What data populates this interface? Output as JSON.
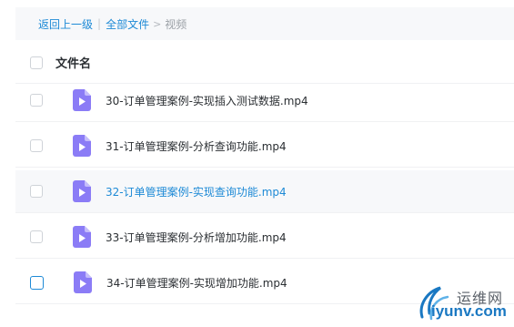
{
  "breadcrumb": {
    "back_label": "返回上一级",
    "separator": "|",
    "all_files_label": "全部文件",
    "arrow": ">",
    "current_label": "视频"
  },
  "table": {
    "header": {
      "name_label": "文件名"
    },
    "rows": [
      {
        "name": "30-订单管理案例-实现插入测试数据.mp4",
        "icon": "video-file-icon",
        "state": "normal"
      },
      {
        "name": "31-订单管理案例-分析查询功能.mp4",
        "icon": "video-file-icon",
        "state": "normal"
      },
      {
        "name": "32-订单管理案例-实现查询功能.mp4",
        "icon": "video-file-icon",
        "state": "hover"
      },
      {
        "name": "33-订单管理案例-分析增加功能.mp4",
        "icon": "video-file-icon",
        "state": "normal"
      },
      {
        "name": "34-订单管理案例-实现增加功能.mp4",
        "icon": "video-file-icon",
        "state": "checkbox-highlighted"
      }
    ]
  },
  "watermark": {
    "title": "运维网",
    "url": "iyunv.com"
  },
  "colors": {
    "link": "#1e8ad6",
    "icon": "#8b7cf6",
    "text": "#2b2f33",
    "muted": "#9ba0a6"
  }
}
